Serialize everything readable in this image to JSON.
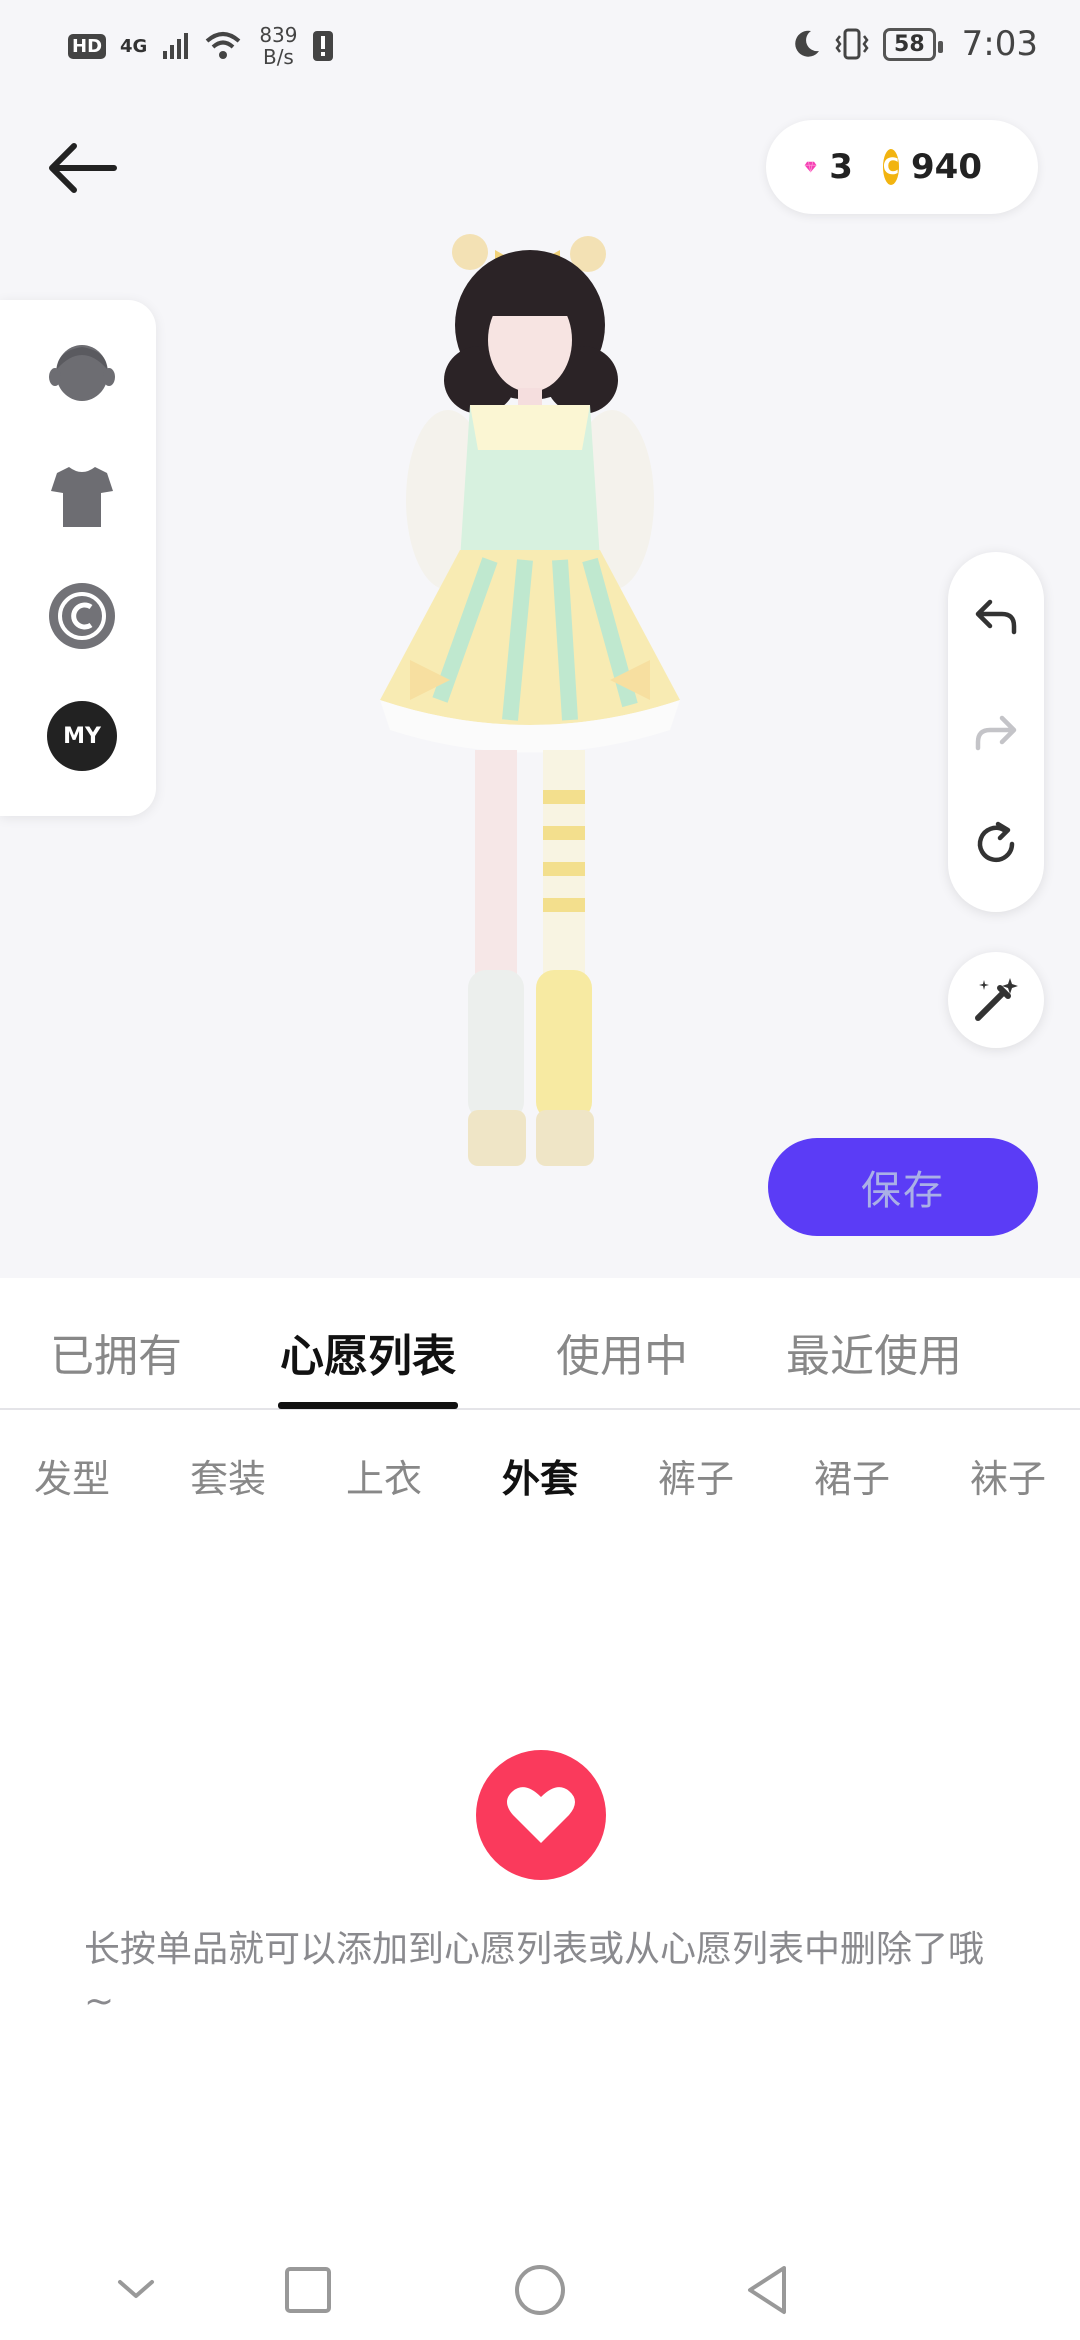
{
  "status_bar": {
    "hd": "HD",
    "network": "4G",
    "speed_value": "839",
    "speed_unit": "B/s",
    "battery": "58",
    "time": "7:03"
  },
  "currency": {
    "gems": "3",
    "coin_symbol": "C",
    "coins": "940",
    "gem_color": "#f53fb3",
    "coin_color": "#f2b410"
  },
  "left_panel": {
    "items": [
      "face-icon",
      "shirt-icon",
      "copyright-icon",
      "my-badge"
    ],
    "my_label": "MY"
  },
  "actions": {
    "save_label": "保存",
    "save_color": "#5b3cf6"
  },
  "tabs": [
    {
      "label": "已拥有"
    },
    {
      "label": "心愿列表"
    },
    {
      "label": "使用中"
    },
    {
      "label": "最近使用"
    }
  ],
  "active_tab": "心愿列表",
  "subcategories": [
    {
      "label": "发型"
    },
    {
      "label": "套装"
    },
    {
      "label": "上衣"
    },
    {
      "label": "外套"
    },
    {
      "label": "裤子"
    },
    {
      "label": "裙子"
    },
    {
      "label": "袜子"
    }
  ],
  "active_subcategory": "外套",
  "empty_state": {
    "message": "长按单品就可以添加到心愿列表或从心愿列表中删除了哦~",
    "heart_color": "#fa3a5c"
  },
  "navbar": [
    "collapse-icon",
    "recents-icon",
    "home-icon",
    "back-nav-icon"
  ]
}
